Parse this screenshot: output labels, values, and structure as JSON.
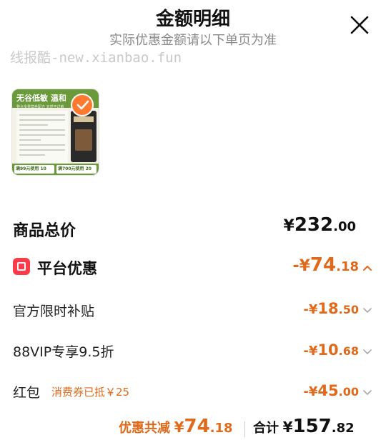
{
  "header": {
    "title": "金额明细",
    "subtitle": "实际优惠金额请以下单页为准"
  },
  "watermark": "线报酷-new.xianbao.fun",
  "product": {
    "banner_text": "无谷低敏 温和",
    "banner_small": "整合多重营养配方 天然不过敏",
    "bag_brand": "ACANA",
    "coupon_1": "满99元使用 10",
    "coupon_2": "满700元使用 20",
    "selected": true
  },
  "summary": {
    "total_label": "商品总价",
    "total_currency": "¥",
    "total_int": "232",
    "total_dec": ".00"
  },
  "platform": {
    "label": "平台优惠",
    "value_prefix": "-¥",
    "value_int": "74",
    "value_dec": ".18",
    "expanded": true
  },
  "discounts": [
    {
      "label": "官方限时补贴",
      "prefix": "-¥",
      "int": "18",
      "dec": ".50"
    },
    {
      "label": "88VIP专享9.5折",
      "prefix": "-¥",
      "int": "10",
      "dec": ".68"
    },
    {
      "label": "红包",
      "prefix": "-¥",
      "int": "45",
      "dec": ".00",
      "note": "消费券已抵￥25"
    }
  ],
  "footer": {
    "saved_label": "优惠共减",
    "saved_currency": "¥",
    "saved_int": "74",
    "saved_dec": ".18",
    "total_label": "合计",
    "total_currency": "¥",
    "total_int": "157",
    "total_dec": ".82"
  },
  "colors": {
    "accent": "#e06a1c",
    "platform_icon": "#ff3b4a",
    "check_badge": "#ff7a2e"
  },
  "icons": {
    "close": "close-icon",
    "check": "check-icon",
    "platform": "red-packet-icon",
    "chevron_up": "chevron-up-icon",
    "chevron_down": "chevron-down-icon"
  }
}
